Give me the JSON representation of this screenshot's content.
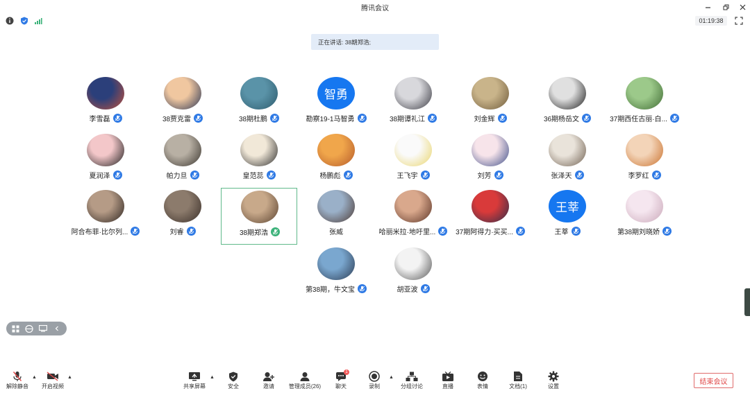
{
  "window": {
    "title": "腾讯会议"
  },
  "infobar": {
    "timer": "01:19:38"
  },
  "speaking": "正在讲话: 38期郑浩;",
  "participants": [
    {
      "name": "李雪磊",
      "colors": [
        "#2b3f7a",
        "#c2513a"
      ]
    },
    {
      "name": "38贾克雷",
      "colors": [
        "#f0c7a0",
        "#2a3554"
      ]
    },
    {
      "name": "38期杜鹏",
      "colors": [
        "#5a93a8",
        "#2d5a6c"
      ]
    },
    {
      "name": "勘察19-1马智勇",
      "text": "智勇"
    },
    {
      "name": "38期谭礼江",
      "colors": [
        "#d8d8dc",
        "#3a3a42"
      ]
    },
    {
      "name": "刘金辉",
      "colors": [
        "#c9b48a",
        "#6e5a3a"
      ]
    },
    {
      "name": "36期杨岳文",
      "colors": [
        "#e0e0e0",
        "#1c1c1c"
      ]
    },
    {
      "name": "37期西任古丽·白...",
      "colors": [
        "#9cc98a",
        "#3f6b33"
      ]
    },
    {
      "name": "夏润泽",
      "colors": [
        "#f3c7c9",
        "#1e1e1e"
      ]
    },
    {
      "name": "帕力旦",
      "colors": [
        "#b8b0a4",
        "#3a352f"
      ]
    },
    {
      "name": "皇范蕊",
      "colors": [
        "#f1e8d8",
        "#2c2c2c"
      ]
    },
    {
      "name": "杨鹏彪",
      "colors": [
        "#f0a64b",
        "#b55a2a"
      ]
    },
    {
      "name": "王飞宇",
      "colors": [
        "#fafafa",
        "#e9d56b"
      ]
    },
    {
      "name": "刘芳",
      "colors": [
        "#f7e4ea",
        "#3d4d88"
      ]
    },
    {
      "name": "张泽天",
      "colors": [
        "#e9e3da",
        "#6f5f50"
      ]
    },
    {
      "name": "李罗红",
      "colors": [
        "#f3d4b8",
        "#c9712d"
      ]
    },
    {
      "name": "阿合布菲·比尔列...",
      "colors": [
        "#b59b86",
        "#2c2420"
      ]
    },
    {
      "name": "刘睿",
      "colors": [
        "#8c7b6c",
        "#3a2f29"
      ]
    },
    {
      "name": "38期郑浩",
      "colors": [
        "#c8a98a",
        "#5a4230"
      ],
      "active": true,
      "mic": "green"
    },
    {
      "name": "张威",
      "colors": [
        "#9ab0c8",
        "#4d3a34"
      ],
      "nomic": true
    },
    {
      "name": "哈丽米拉·地吁里...",
      "colors": [
        "#d9a88c",
        "#5a3326"
      ]
    },
    {
      "name": "37期阿得力·买买...",
      "colors": [
        "#d93a3a",
        "#2e2e4a"
      ]
    },
    {
      "name": "王莘",
      "text": "王莘"
    },
    {
      "name": "第38期刘晓娇",
      "colors": [
        "#f5e6ef",
        "#c9a7b8"
      ]
    },
    {
      "name": "第38期，牛文宝",
      "colors": [
        "#7aa7cf",
        "#2b3b52"
      ]
    },
    {
      "name": "胡亚波",
      "colors": [
        "#f3f3f3",
        "#555555"
      ]
    }
  ],
  "toolbar": {
    "unmute": "解除静音",
    "video": "开启视频",
    "share": "共享屏幕",
    "security": "安全",
    "invite": "邀请",
    "members": "管理成员(26)",
    "chat": "聊天",
    "chat_badge": "1",
    "record": "录制",
    "breakout": "分组讨论",
    "live": "直播",
    "reactions": "表情",
    "docs": "文档(1)",
    "settings": "设置",
    "end": "结束会议"
  },
  "colors": {
    "accent": "#2f7ae5",
    "active_border": "#5fb98a",
    "end": "#e04848"
  }
}
